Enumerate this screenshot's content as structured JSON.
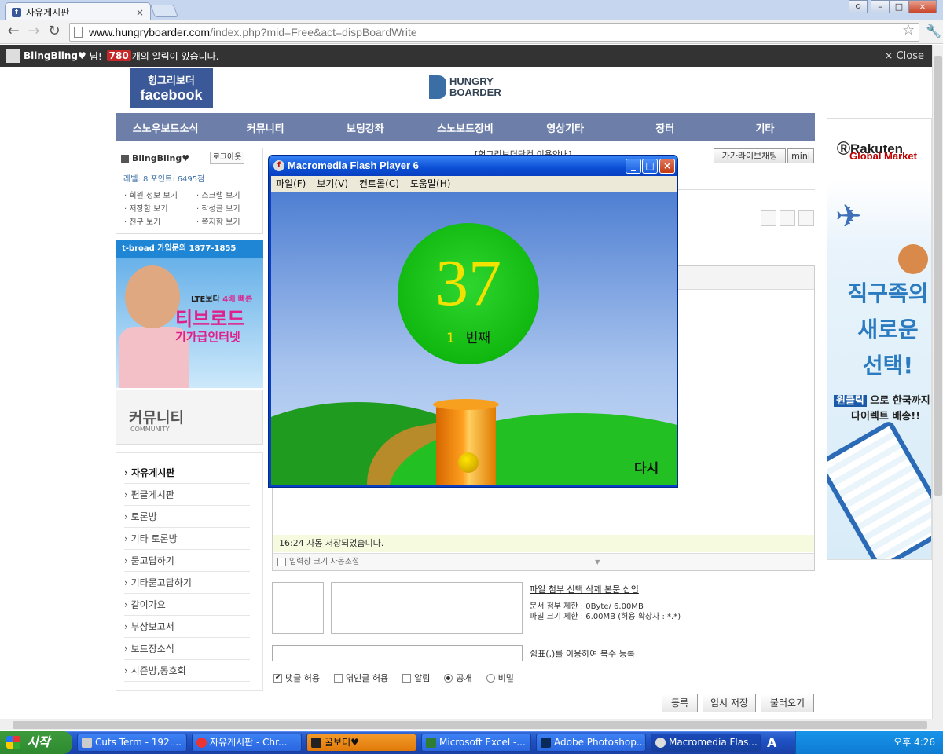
{
  "browser": {
    "tab_title": "자유게시판",
    "tab_close": "×",
    "url_host": "www.hungryboarder.com",
    "url_path": "/index.php?mid=Free&act=dispBoardWrite",
    "window_buttons": [
      "ㅇ",
      "–",
      "□",
      "×"
    ]
  },
  "notification": {
    "user": "BlingBling♥",
    "honorific": "님!",
    "count": "780",
    "message": "개의 알림이 있습니다.",
    "close": "× Close"
  },
  "site": {
    "fb_line1": "헝그리보더",
    "fb_line2": "facebook",
    "logo_line1": "HUNGRY",
    "logo_line2": "BOARDER",
    "nav": [
      "스노우보드소식",
      "커뮤니티",
      "보딩강좌",
      "스노보드장비",
      "영상기타",
      "장터",
      "기타"
    ]
  },
  "userbox": {
    "name": "BlingBling♥",
    "logout": "로그아웃",
    "level_points": "레벨: 8  포인트: 6495점",
    "links": [
      "회원 정보 보기",
      "스크랩 보기",
      "저장함 보기",
      "작성글 보기",
      "친구 보기",
      "쪽지함 보기"
    ]
  },
  "ad_tbroad": {
    "header": "t-broad  가입문의 1877-1855",
    "line1_pre": "LTE보다 ",
    "line1_em": "4배 빠른",
    "line2": "티브로드",
    "line3": "기가급인터넷"
  },
  "community": {
    "title": "커뮤니티",
    "subtitle": "COMMUNITY"
  },
  "boards": [
    "› 자유게시판",
    "› 편글게시판",
    "› 토론방",
    "› 기타 토론방",
    "› 묻고답하기",
    "› 기타묻고답하기",
    "› 같이가요",
    "› 부상보고서",
    "› 보드장소식",
    "› 시즌방,동호회"
  ],
  "main": {
    "title_partial": "[헝그리보더닷컴 이용안내]",
    "chat_button": "가가라이브채팅",
    "mini_button": "mini",
    "autosave": "16:24 자동 저장되었습니다.",
    "resize_label": "입력창 크기 자동조절",
    "resize_arrow": "▼",
    "file_links": "파일 첨부  선택 삭제  본문 삽입",
    "file_info1": "문서 첨부 제한 : 0Byte/ 6.00MB",
    "file_info2": "파일 크기 제한 : 6.00MB (허용 확장자 : *.*)",
    "tag_hint": "쉼표(,)를 이용하여 복수 등록",
    "options": {
      "comment": "댓글 허용",
      "trackback": "엮인글 허용",
      "notify": "알림",
      "public": "공개",
      "secret": "비밀"
    },
    "buttons": {
      "submit": "등록",
      "temp_save": "임시 저장",
      "load": "불러오기"
    }
  },
  "ad_rakuten": {
    "brand": "Rakuten",
    "sub": "Global Market",
    "headline": [
      "직구족의",
      "새로운",
      "선택!"
    ],
    "line1_em": "원클릭",
    "line1_rest": " 으로 한국까지",
    "line2": "다이렉트 배송!!"
  },
  "flash": {
    "title": "Macromedia Flash Player 6",
    "menu": [
      "파일(F)",
      "보기(V)",
      "컨트롤(C)",
      "도움말(H)"
    ],
    "number": "37",
    "ordinal_num": "1",
    "ordinal_word": "번째",
    "again": "다시",
    "controls": [
      "_",
      "□",
      "×"
    ]
  },
  "taskbar": {
    "start": "시작",
    "items": [
      "Cuts Term - 192....",
      "자유게시판 - Chr...",
      "꿀보더♥",
      "Microsoft Excel -...",
      "Adobe Photoshop...",
      "Macromedia Flas..."
    ],
    "lang": "A",
    "clock": "오후 4:26"
  },
  "colors": {
    "nav_bg": "#6d7fa9",
    "fb_blue": "#3b5998",
    "ball_green": "#10b810",
    "number_yellow": "#f3e200",
    "xp_blue": "#1f51c4"
  }
}
